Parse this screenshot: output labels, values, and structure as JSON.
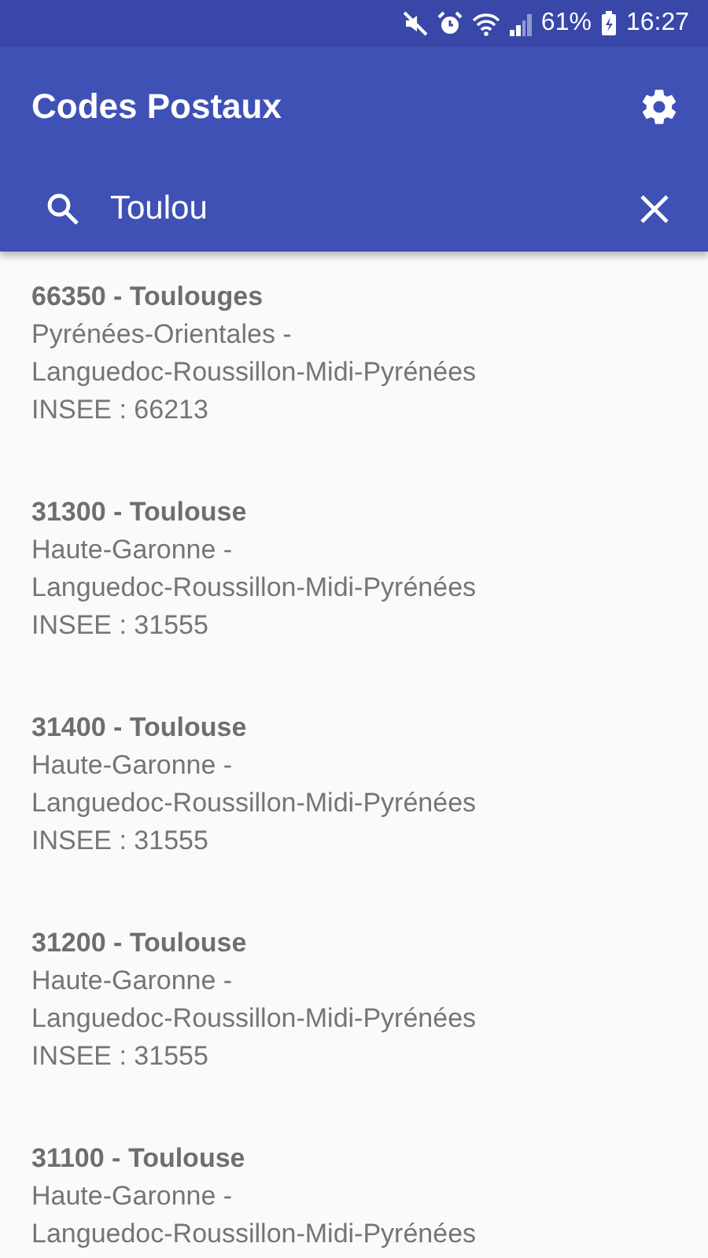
{
  "status_bar": {
    "battery_percent": "61%",
    "time": "16:27"
  },
  "app_bar": {
    "title": "Codes Postaux"
  },
  "search": {
    "value": "Toulou"
  },
  "results": [
    {
      "title": "66350 - Toulouges",
      "department": "Pyrénées-Orientales -",
      "region": "Languedoc-Roussillon-Midi-Pyrénées",
      "insee": "INSEE : 66213"
    },
    {
      "title": "31300 - Toulouse",
      "department": "Haute-Garonne -",
      "region": "Languedoc-Roussillon-Midi-Pyrénées",
      "insee": "INSEE : 31555"
    },
    {
      "title": "31400 - Toulouse",
      "department": "Haute-Garonne -",
      "region": "Languedoc-Roussillon-Midi-Pyrénées",
      "insee": "INSEE : 31555"
    },
    {
      "title": "31200 - Toulouse",
      "department": "Haute-Garonne -",
      "region": "Languedoc-Roussillon-Midi-Pyrénées",
      "insee": "INSEE : 31555"
    },
    {
      "title": "31100 - Toulouse",
      "department": "Haute-Garonne -",
      "region": "Languedoc-Roussillon-Midi-Pyrénées"
    }
  ]
}
